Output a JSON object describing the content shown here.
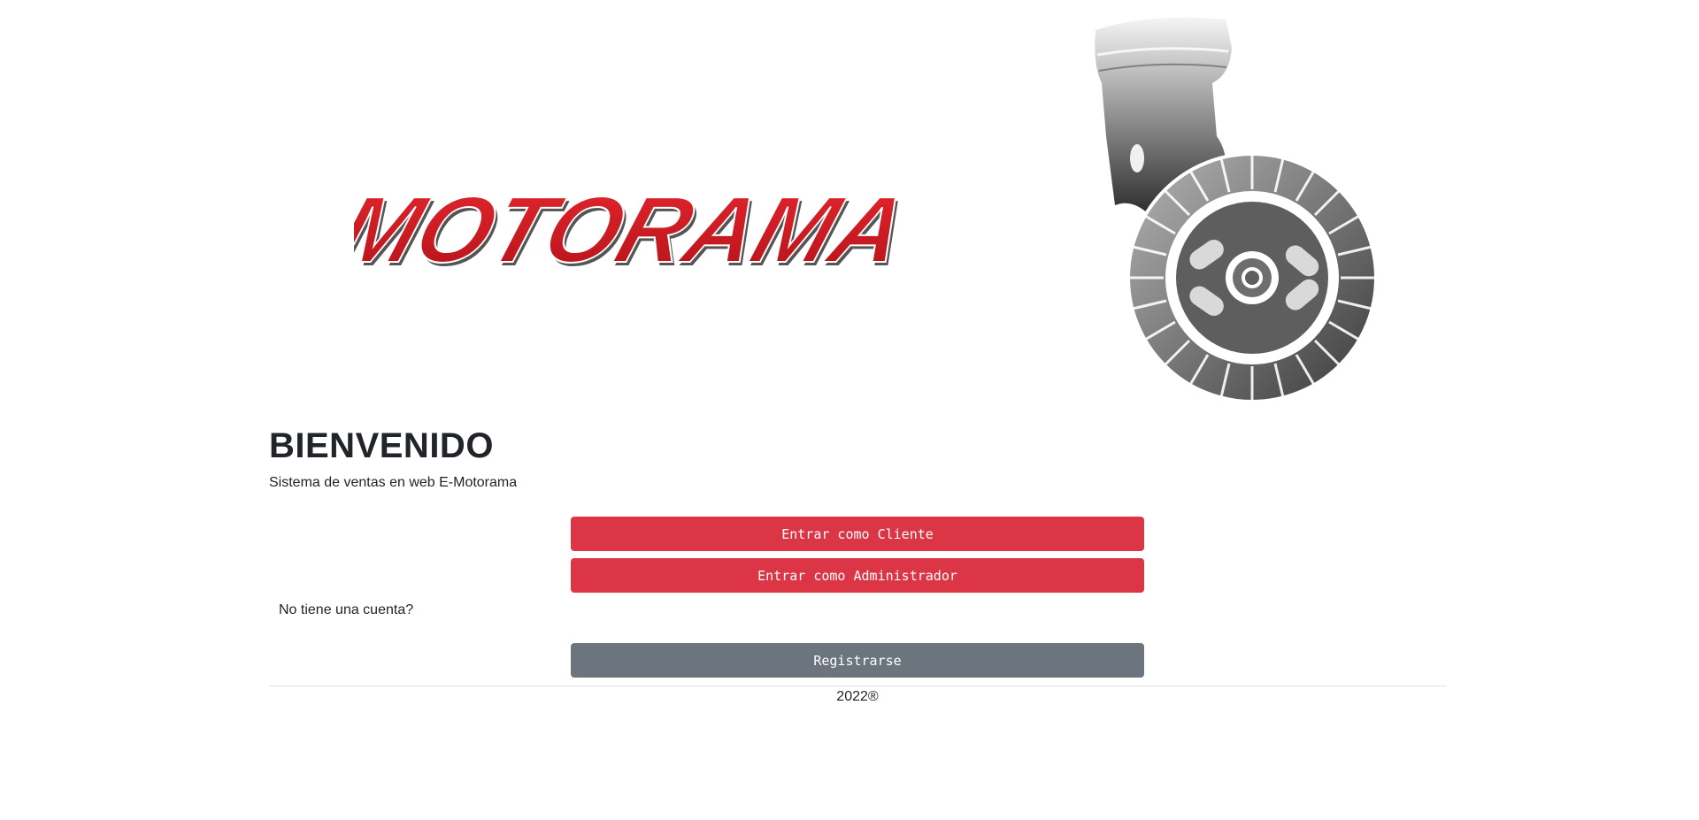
{
  "brand": {
    "logo_text": "MOTORAMA",
    "logo_color": "#d71920",
    "logo_icon": "piston-clutch-logo"
  },
  "welcome": {
    "title": "BIENVENIDO",
    "subtitle": "Sistema de ventas en web E-Motorama"
  },
  "actions": {
    "client_label": "Entrar como Cliente",
    "admin_label": "Entrar como Administrador",
    "no_account_text": "No tiene una cuenta?",
    "register_label": "Registrarse"
  },
  "footer": {
    "text": "2022®"
  },
  "colors": {
    "primary_button": "#dc3545",
    "secondary_button": "#6c757d"
  }
}
